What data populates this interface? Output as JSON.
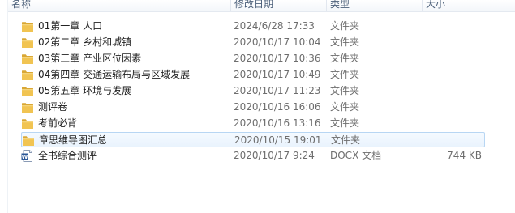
{
  "columns": {
    "name": "名称",
    "date": "修改日期",
    "type": "类型",
    "size": "大小"
  },
  "files": [
    {
      "name": "01第一章  人口",
      "date": "2024/6/28 17:33",
      "type": "文件夹",
      "size": "",
      "icon": "folder-icon"
    },
    {
      "name": "02第二章  乡村和城镇",
      "date": "2020/10/17 10:04",
      "type": "文件夹",
      "size": "",
      "icon": "folder-icon"
    },
    {
      "name": "03第三章  产业区位因素",
      "date": "2020/10/17 10:36",
      "type": "文件夹",
      "size": "",
      "icon": "folder-icon"
    },
    {
      "name": "04第四章  交通运输布局与区域发展",
      "date": "2020/10/17 10:49",
      "type": "文件夹",
      "size": "",
      "icon": "folder-icon"
    },
    {
      "name": "05第五章  环境与发展",
      "date": "2020/10/17 11:23",
      "type": "文件夹",
      "size": "",
      "icon": "folder-icon"
    },
    {
      "name": "测评卷",
      "date": "2020/10/16 16:06",
      "type": "文件夹",
      "size": "",
      "icon": "folder-icon"
    },
    {
      "name": "考前必背",
      "date": "2020/10/16 13:16",
      "type": "文件夹",
      "size": "",
      "icon": "folder-icon"
    },
    {
      "name": "章思维导图汇总",
      "date": "2020/10/15 19:01",
      "type": "文件夹",
      "size": "",
      "icon": "folder-icon",
      "selected": true
    },
    {
      "name": "全书综合测评",
      "date": "2020/10/17 9:24",
      "type": "DOCX 文档",
      "size": "744 KB",
      "icon": "word-doc-icon"
    }
  ],
  "colors": {
    "folder": "#f1c452",
    "folder_dark": "#d9a735",
    "selection_border": "#b8d6f3",
    "word_blue": "#2b5797"
  }
}
